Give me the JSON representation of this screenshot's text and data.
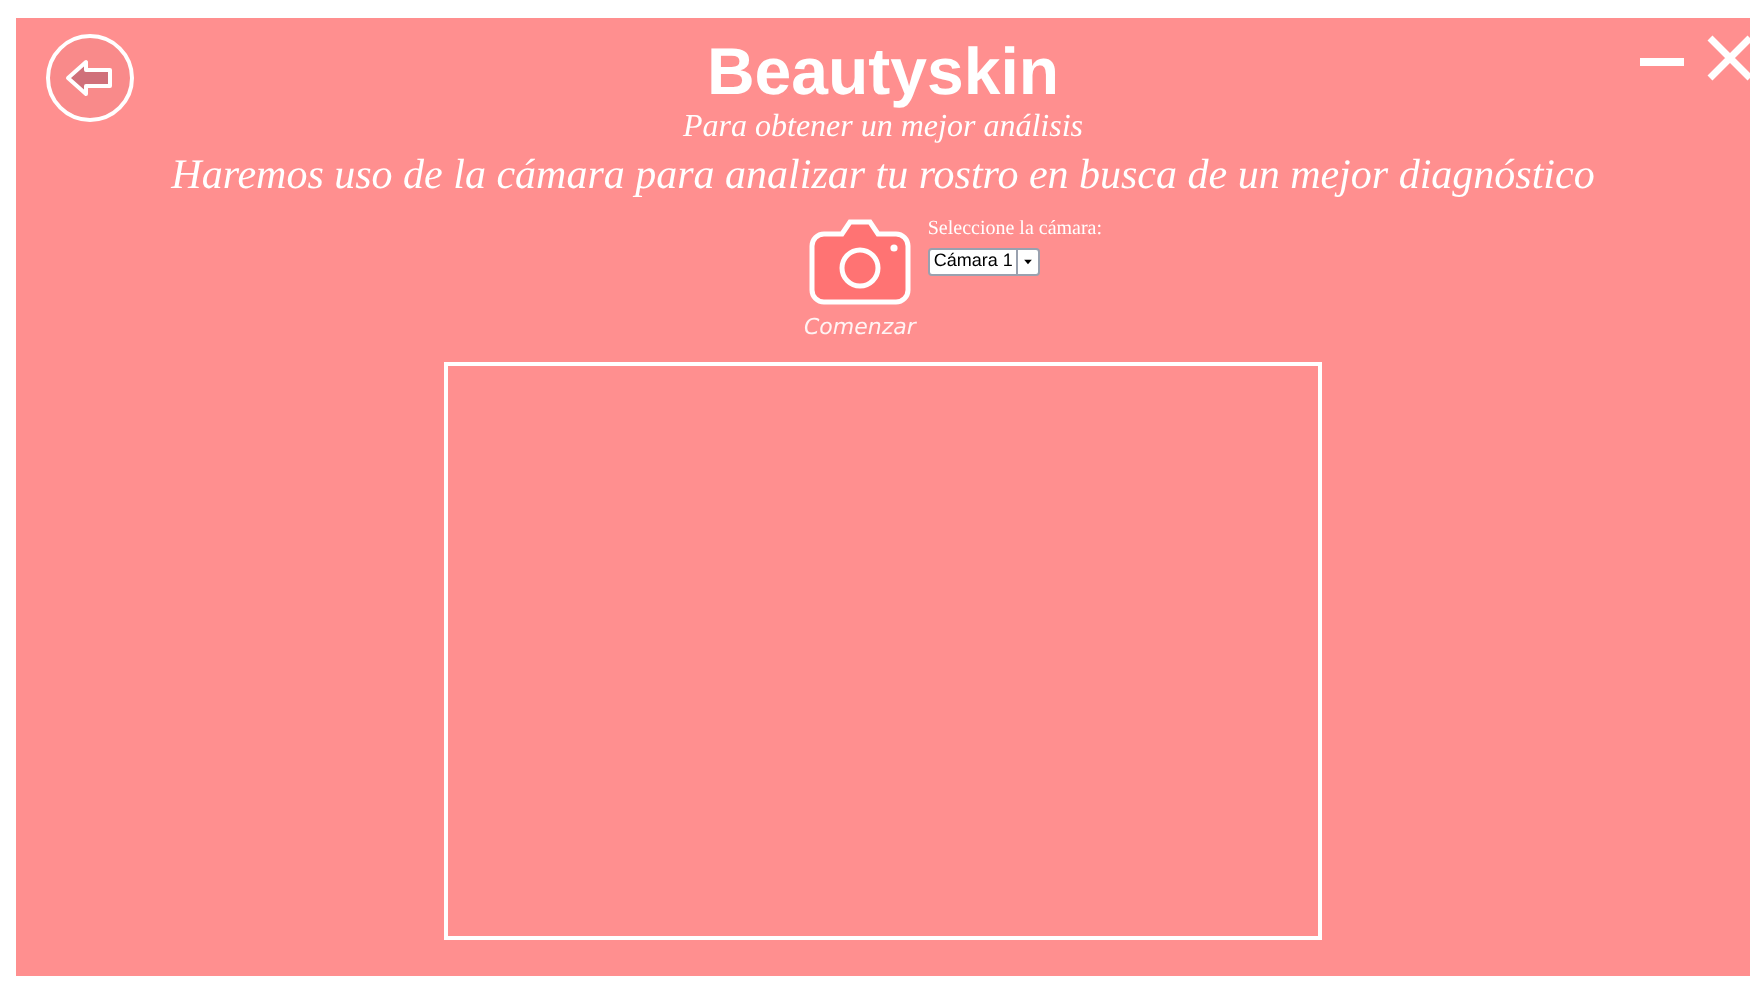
{
  "header": {
    "title": "Beautyskin",
    "subtitle": "Para obtener un mejor análisis",
    "description": "Haremos uso de la cámara para analizar tu rostro en busca de un mejor diagnóstico"
  },
  "camera": {
    "start_label": "Comenzar",
    "select_label": "Seleccione la cámara:",
    "selected_camera": "Cámara 1"
  }
}
